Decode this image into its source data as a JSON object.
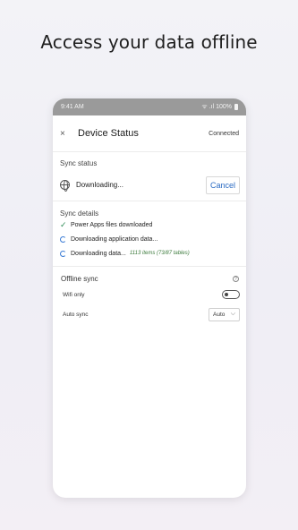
{
  "headline": "Access your data offline",
  "status_bar": {
    "time": "9:41 AM",
    "indicators": "ᯤ .ıl 100%"
  },
  "header": {
    "close_glyph": "×",
    "title": "Device Status",
    "connection": "Connected"
  },
  "sync_status": {
    "label": "Sync status",
    "icon": "globe-icon",
    "text": "Downloading...",
    "cancel_label": "Cancel"
  },
  "sync_details": {
    "label": "Sync details",
    "items": [
      {
        "icon": "check-icon",
        "glyph": "✓",
        "text": "Power Apps files downloaded",
        "sub": ""
      },
      {
        "icon": "spinner-icon",
        "text": "Downloading application data...",
        "sub": ""
      },
      {
        "icon": "spinner-icon",
        "text": "Downloading data...",
        "sub": "1113 items (73/87 tables)"
      }
    ]
  },
  "offline_sync": {
    "label": "Offline sync",
    "help_glyph": "?",
    "wifi_label": "Wifi only",
    "wifi_on": false,
    "auto_label": "Auto sync",
    "auto_value": "Auto",
    "chevron": "⌵"
  },
  "colors": {
    "accent": "#2c6cc4",
    "success": "#2e8b57",
    "statusbar": "#9a9a9a"
  }
}
